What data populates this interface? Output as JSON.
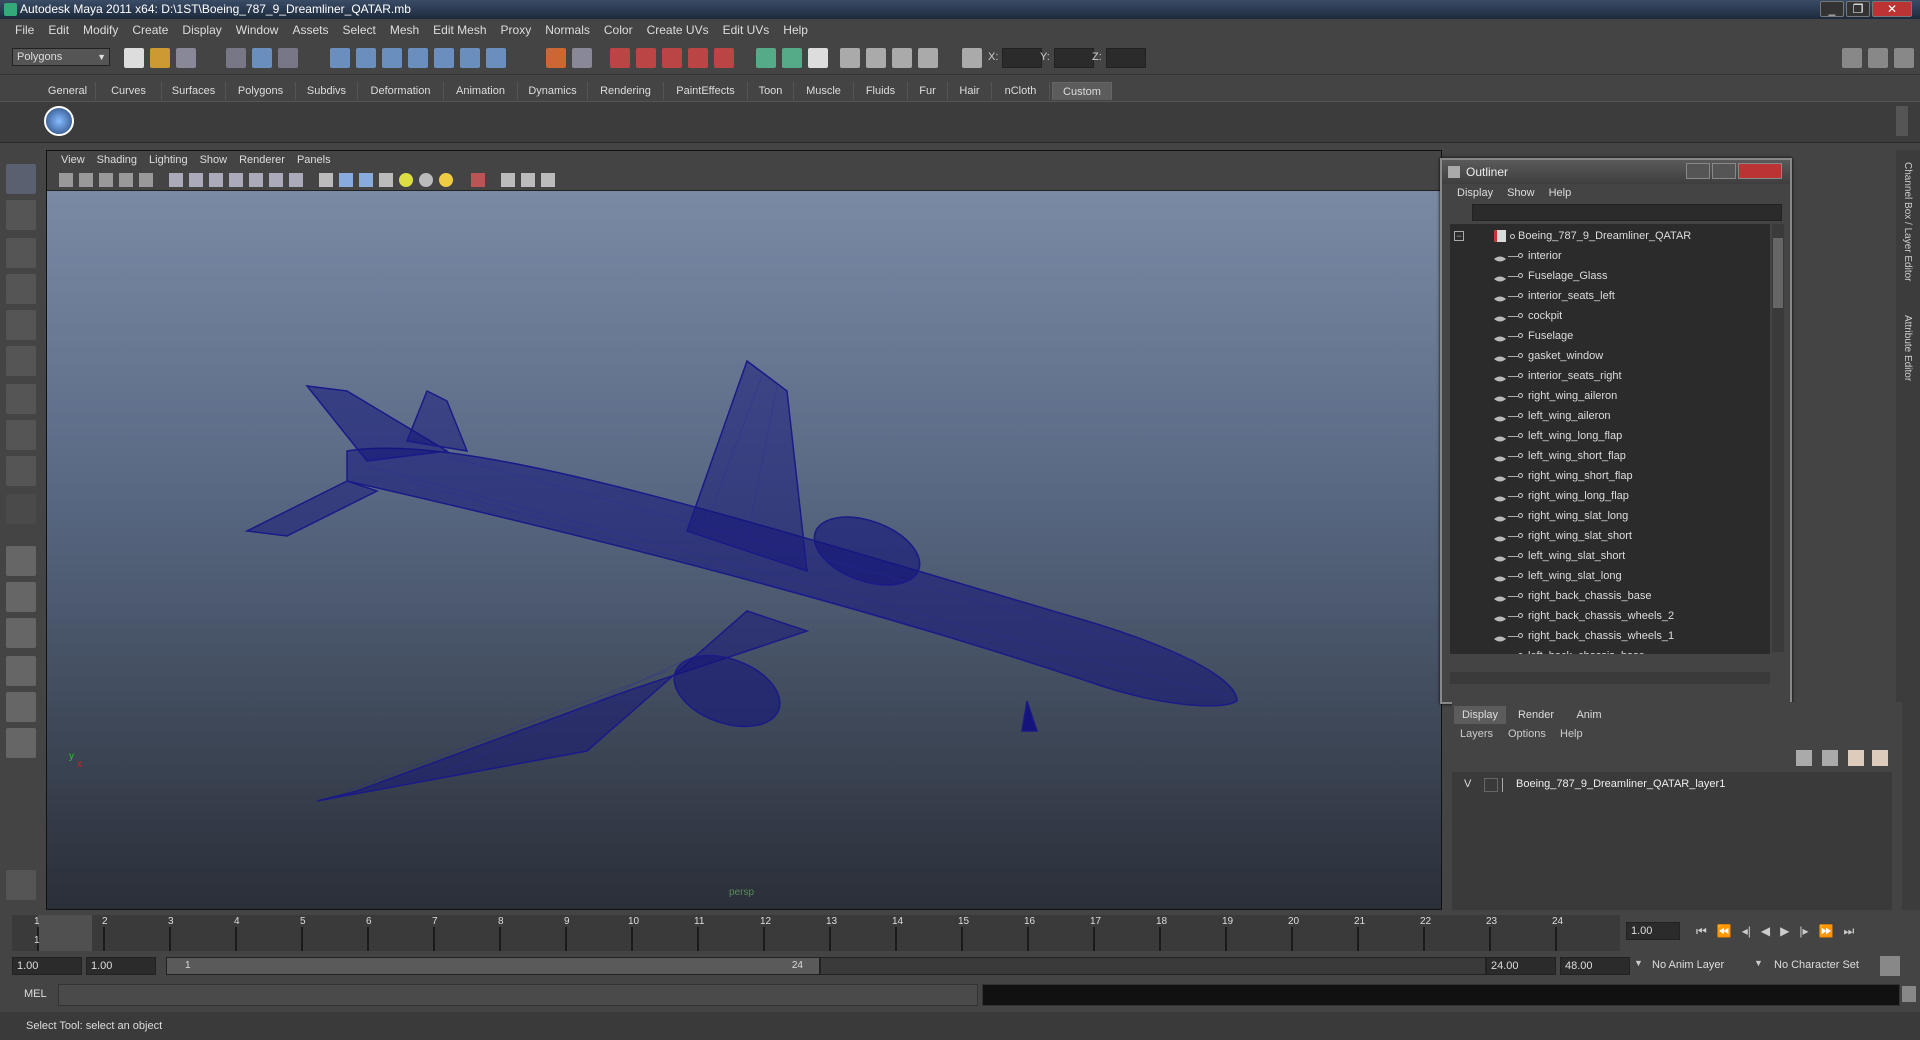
{
  "window": {
    "title": "Autodesk Maya 2011 x64: D:\\1ST\\Boeing_787_9_Dreamliner_QATAR.mb",
    "min": "_",
    "max": "❐",
    "close": "✕"
  },
  "menu": [
    "File",
    "Edit",
    "Modify",
    "Create",
    "Display",
    "Window",
    "Assets",
    "Select",
    "Mesh",
    "Edit Mesh",
    "Proxy",
    "Normals",
    "Color",
    "Create UVs",
    "Edit UVs",
    "Help"
  ],
  "status": {
    "mode": "Polygons",
    "x_label": "X:",
    "y_label": "Y:",
    "z_label": "Z:"
  },
  "shelf_tabs": [
    "General",
    "Curves",
    "Surfaces",
    "Polygons",
    "Subdivs",
    "Deformation",
    "Animation",
    "Dynamics",
    "Rendering",
    "PaintEffects",
    "Toon",
    "Muscle",
    "Fluids",
    "Fur",
    "Hair",
    "nCloth",
    "Custom"
  ],
  "shelf_active": "Custom",
  "viewport": {
    "menu": [
      "View",
      "Shading",
      "Lighting",
      "Show",
      "Renderer",
      "Panels"
    ],
    "camera_label": "persp",
    "axis_x": "x",
    "axis_y": "y"
  },
  "outliner": {
    "title": "Outliner",
    "menu": [
      "Display",
      "Show",
      "Help"
    ],
    "root": "Boeing_787_9_Dreamliner_QATAR",
    "items": [
      "interior",
      "Fuselage_Glass",
      "interior_seats_left",
      "cockpit",
      "Fuselage",
      "gasket_window",
      "interior_seats_right",
      "right_wing_aileron",
      "left_wing_aileron",
      "left_wing_long_flap",
      "left_wing_short_flap",
      "right_wing_short_flap",
      "right_wing_long_flap",
      "right_wing_slat_long",
      "right_wing_slat_short",
      "left_wing_slat_short",
      "left_wing_slat_long",
      "right_back_chassis_base",
      "right_back_chassis_wheels_2",
      "right_back_chassis_wheels_1",
      "left_back_chassis_base"
    ]
  },
  "channel_box_label": "Channel Box / Layer Editor",
  "attribute_editor_label": "Attribute Editor",
  "layers": {
    "tabs": [
      "Display",
      "Render",
      "Anim"
    ],
    "menu": [
      "Layers",
      "Options",
      "Help"
    ],
    "layer_vis": "V",
    "layer_name": "Boeing_787_9_Dreamliner_QATAR_layer1"
  },
  "timeline": {
    "ticks": [
      "1",
      "2",
      "3",
      "4",
      "5",
      "6",
      "7",
      "8",
      "9",
      "10",
      "11",
      "12",
      "13",
      "14",
      "15",
      "16",
      "17",
      "18",
      "19",
      "20",
      "21",
      "22",
      "23",
      "24"
    ],
    "current": "1",
    "current_field": "1.00"
  },
  "range": {
    "start": "1.00",
    "start2": "1.00",
    "slider_start": "1",
    "slider_end": "24",
    "end": "24.00",
    "end2": "48.00",
    "anim_layer": "No Anim Layer",
    "char_set": "No Character Set"
  },
  "cmd": {
    "label": "MEL"
  },
  "help_text": "Select Tool: select an object"
}
